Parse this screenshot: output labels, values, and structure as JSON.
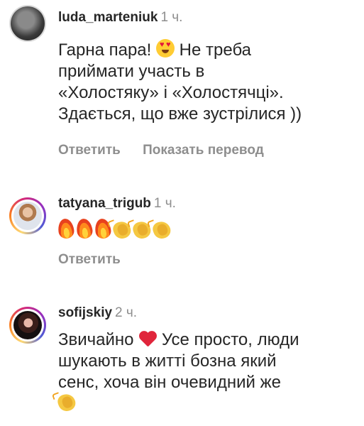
{
  "comments": [
    {
      "username": "luda_marteniuk",
      "time": "1 ч.",
      "avatar_icon": "profile-photo-plain",
      "text_lines": [
        "Гарна пара!",
        "Не треба",
        "приймати участь в",
        "«Холостяку» і «Холостячці».",
        "Здається, що вже зустрілися ))"
      ],
      "emojis": [
        "heart-eyes-face"
      ],
      "reply_label": "Ответить",
      "translate_label": "Показать перевод"
    },
    {
      "username": "tatyana_trigub",
      "time": "1 ч.",
      "avatar_icon": "profile-photo-story-ring",
      "emojis": [
        "fire",
        "fire",
        "fire",
        "clapping-hands",
        "clapping-hands",
        "clapping-hands"
      ],
      "reply_label": "Ответить"
    },
    {
      "username": "sofijskiy",
      "time": "2 ч.",
      "avatar_icon": "profile-photo-story-ring",
      "text_lines": [
        "Звичайно",
        "Усе просто, люди",
        "шукають в житті бозна який",
        "сенс, хоча він очевидний же"
      ],
      "emojis": [
        "red-heart",
        "clapping-hands"
      ]
    }
  ],
  "colors": {
    "text": "#262626",
    "secondary": "#8e8e8e",
    "story_ring": [
      "#feda75",
      "#fa7e1e",
      "#d62976",
      "#962fbf",
      "#4f5bd5"
    ]
  }
}
